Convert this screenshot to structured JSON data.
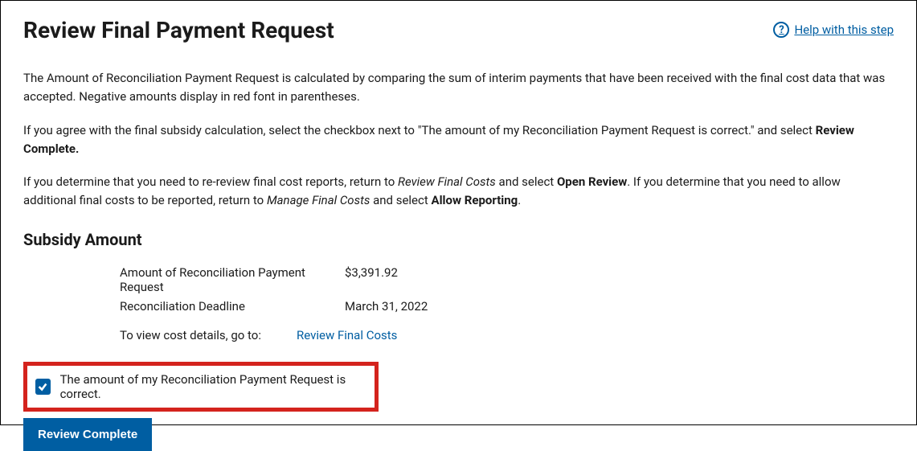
{
  "header": {
    "title": "Review Final Payment Request",
    "help_label": "Help with this step"
  },
  "intro": {
    "p1": "The Amount of Reconciliation Payment Request is calculated by comparing the sum of interim payments that have been received with the final cost data that was accepted. Negative amounts display in red font in parentheses.",
    "p2_a": "If you agree with the final subsidy calculation, select the checkbox next to \"The amount of my Reconciliation Payment Request is correct.\" and select ",
    "p2_b": "Review Complete.",
    "p3_a": "If you determine that you need to re-review final cost reports, return to ",
    "p3_b": "Review Final Costs",
    "p3_c": " and select ",
    "p3_d": "Open Review",
    "p3_e": ". If you determine that you need to allow additional final costs to be reported, return to ",
    "p3_f": "Manage Final Costs",
    "p3_g": " and select ",
    "p3_h": "Allow Reporting",
    "p3_i": "."
  },
  "subsidy": {
    "heading": "Subsidy Amount",
    "amount_label": "Amount of Reconciliation Payment Request",
    "amount_value": "$3,391.92",
    "deadline_label": "Reconciliation Deadline",
    "deadline_value": "March 31, 2022",
    "details_label": "To view cost details, go to:",
    "details_link": "Review Final Costs"
  },
  "confirmation": {
    "checkbox_label": "The amount of my Reconciliation Payment Request is correct.",
    "button_label": "Review Complete"
  }
}
